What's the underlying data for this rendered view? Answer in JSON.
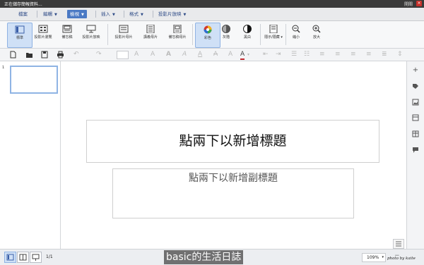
{
  "window": {
    "title": "正在儲存簡報資料...",
    "switch_label": "開關",
    "close_label": "×"
  },
  "menu": [
    {
      "label": "檔案",
      "dropdown": false
    },
    {
      "label": "編輯",
      "dropdown": true
    },
    {
      "label": "檢視",
      "dropdown": true,
      "active": true
    },
    {
      "label": "插入",
      "dropdown": true
    },
    {
      "label": "格式",
      "dropdown": true
    },
    {
      "label": "投影片放映",
      "dropdown": true
    }
  ],
  "ribbon": {
    "view_modes": [
      "標準",
      "投影片瀏覽",
      "備忘稿",
      "投影片放映"
    ],
    "masters": [
      "投影片母片",
      "講義母片",
      "備忘稿母片"
    ],
    "color_modes": [
      "彩色",
      "灰階",
      "黑白"
    ],
    "show_hide": "隱示/隱藏",
    "zoom_out": "縮小",
    "zoom_in": "放大"
  },
  "slide": {
    "number": "1",
    "title_placeholder": "點兩下以新增標題",
    "subtitle_placeholder": "點兩下以新增副標題"
  },
  "status": {
    "page": "1/1",
    "zoom": "109%"
  },
  "watermark": "basic的生活日誌",
  "signature": "photo by kaite",
  "colors": {
    "accent": "#4a79c4",
    "menu_text": "#2d4a86",
    "close": "#c8302a"
  }
}
